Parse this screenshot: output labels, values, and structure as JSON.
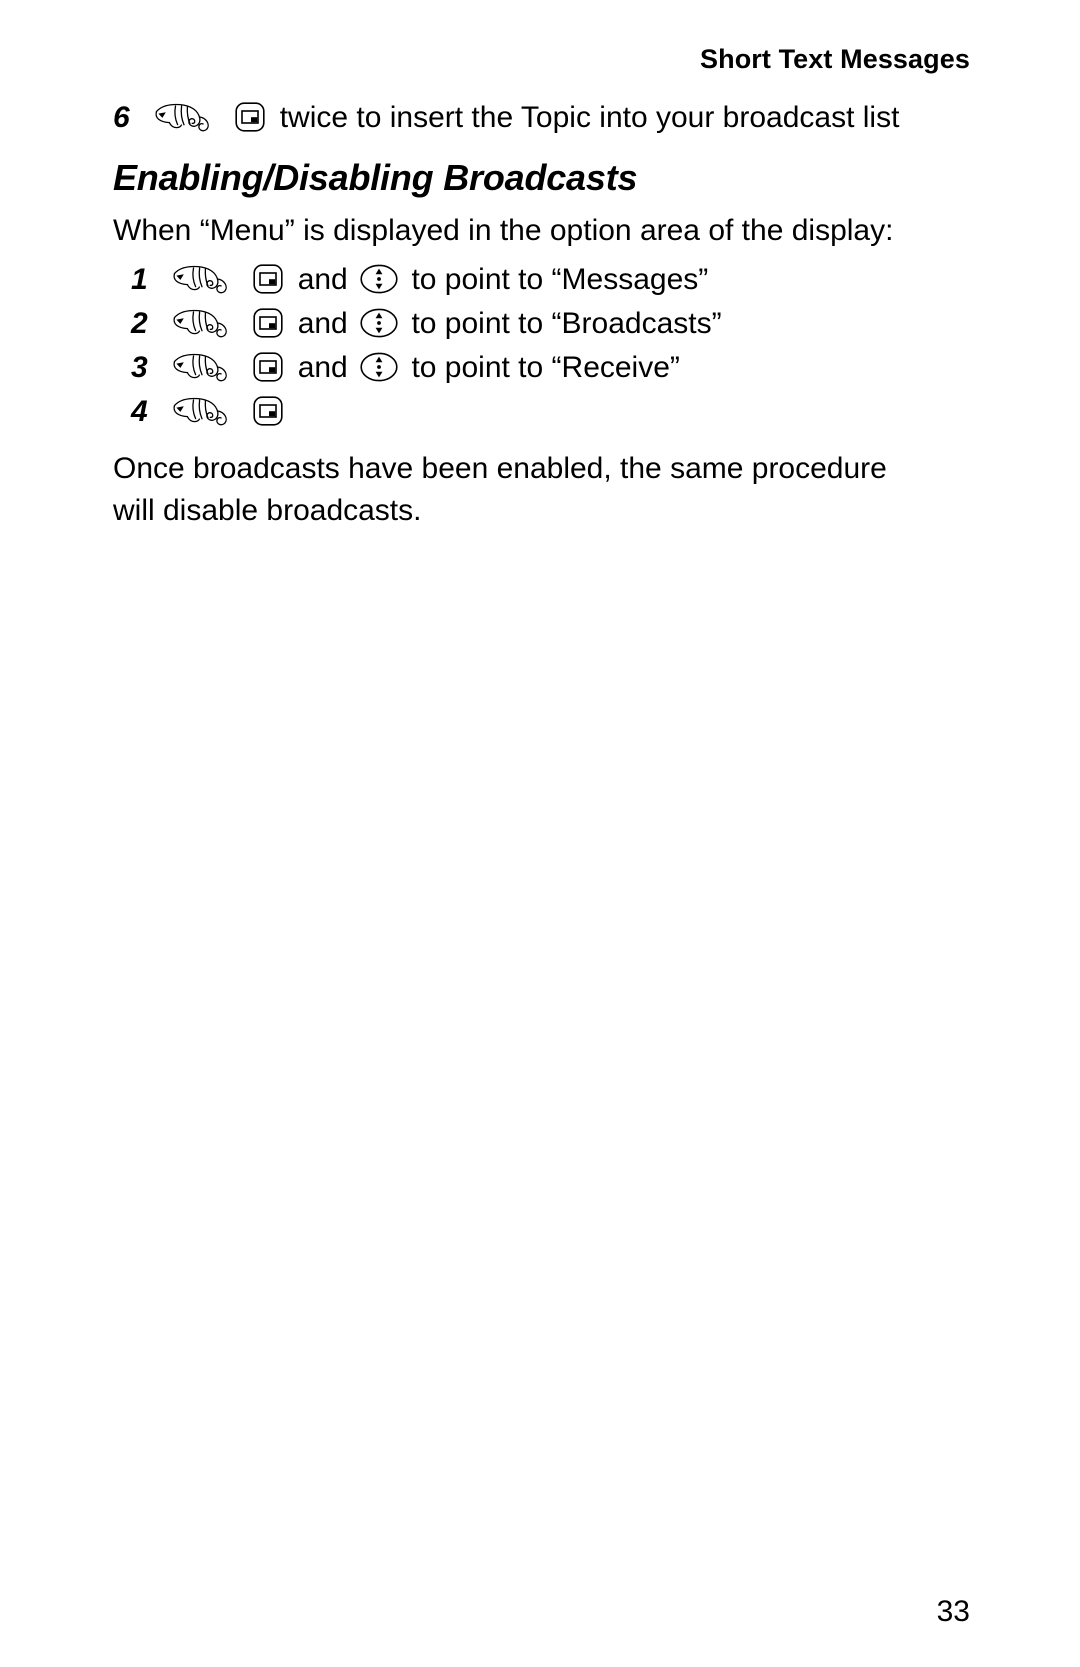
{
  "header": {
    "running_head": "Short Text Messages"
  },
  "icons": {
    "hand": "pointing-hand-icon",
    "select_key": "select-key-icon",
    "scroll_key": "scroll-key-icon"
  },
  "content": {
    "step_six": {
      "number": "6",
      "text": "twice to insert the Topic into your broadcast list"
    },
    "section_heading": "Enabling/Disabling Broadcasts",
    "intro": "When “Menu” is displayed in the option area of the display:",
    "steps": [
      {
        "number": "1",
        "conjunction": "and",
        "text": "to point to “Messages”",
        "has_scroll": true
      },
      {
        "number": "2",
        "conjunction": "and",
        "text": "to point to “Broadcasts”",
        "has_scroll": true
      },
      {
        "number": "3",
        "conjunction": "and",
        "text": "to point to “Receive”",
        "has_scroll": true
      },
      {
        "number": "4",
        "conjunction": "",
        "text": "",
        "has_scroll": false
      }
    ],
    "closing": "Once broadcasts have been enabled, the same procedure will disable broadcasts."
  },
  "footer": {
    "page_number": "33"
  },
  "colors": {
    "text": "#000000",
    "background": "#ffffff"
  }
}
